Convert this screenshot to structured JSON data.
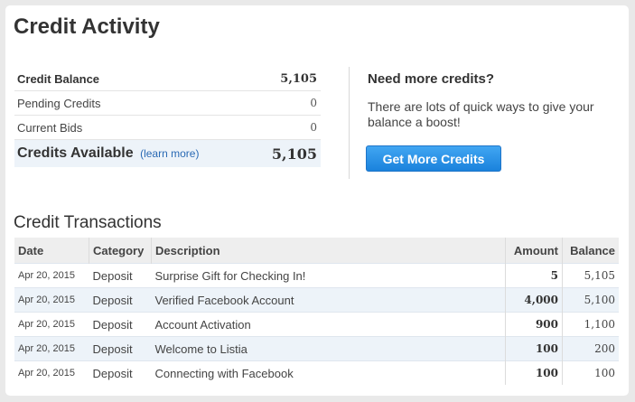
{
  "page": {
    "title": "Credit Activity"
  },
  "summary": {
    "rows": [
      {
        "label": "Credit Balance",
        "value": "5,105"
      },
      {
        "label": "Pending Credits",
        "value": "0"
      },
      {
        "label": "Current Bids",
        "value": "0"
      }
    ],
    "available": {
      "label": "Credits Available",
      "link": "(learn more)",
      "value": "5,105"
    }
  },
  "promo": {
    "title": "Need more credits?",
    "text": "There are lots of quick ways to give your balance a boost!",
    "button": "Get More Credits"
  },
  "transactions": {
    "title": "Credit Transactions",
    "headers": {
      "date": "Date",
      "category": "Category",
      "description": "Description",
      "amount": "Amount",
      "balance": "Balance"
    },
    "rows": [
      {
        "date": "Apr 20, 2015",
        "category": "Deposit",
        "description": "Surprise Gift for Checking In!",
        "amount": "5",
        "balance": "5,105"
      },
      {
        "date": "Apr 20, 2015",
        "category": "Deposit",
        "description": "Verified Facebook Account",
        "amount": "4,000",
        "balance": "5,100"
      },
      {
        "date": "Apr 20, 2015",
        "category": "Deposit",
        "description": "Account Activation",
        "amount": "900",
        "balance": "1,100"
      },
      {
        "date": "Apr 20, 2015",
        "category": "Deposit",
        "description": "Welcome to Listia",
        "amount": "100",
        "balance": "200"
      },
      {
        "date": "Apr 20, 2015",
        "category": "Deposit",
        "description": "Connecting with Facebook",
        "amount": "100",
        "balance": "100"
      }
    ]
  }
}
